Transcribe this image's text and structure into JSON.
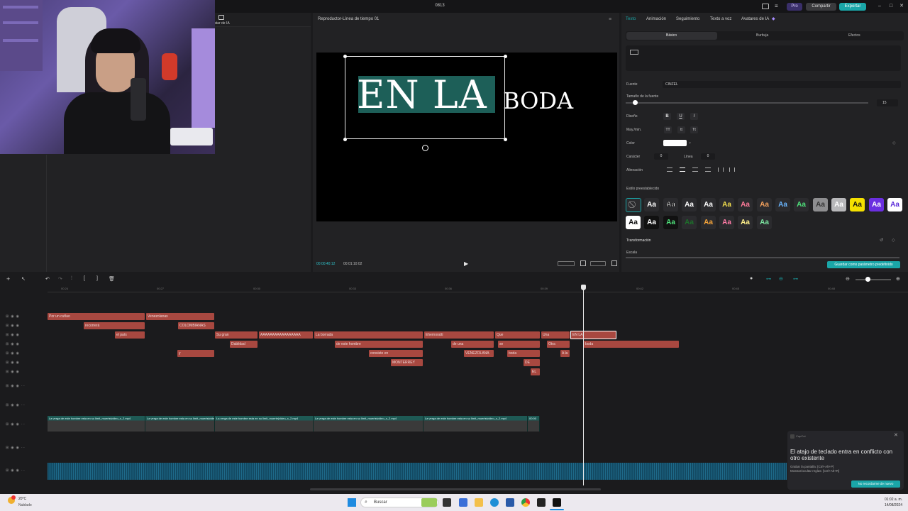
{
  "window": {
    "title": "0813",
    "pro": "Pro",
    "share": "Compartir",
    "export": "Exportar"
  },
  "left_panel": {
    "item_label": "atar de IA"
  },
  "player": {
    "title": "Reproductor-Línea de tiempo 01",
    "overlay_main": "EN LA",
    "overlay_second": "BODA",
    "time_current": "00:00:40:12",
    "time_total": "00:01:10:02"
  },
  "inspector": {
    "tabs": [
      "Texto",
      "Animación",
      "Seguimiento",
      "Texto a voz",
      "Avatares de IA"
    ],
    "subtabs": [
      "Básico",
      "Burbuja",
      "Efectos"
    ],
    "font_label": "Fuente",
    "font_value": "CINZEL",
    "size_label": "Tamaño de la fuente",
    "size_value": "15",
    "size_fraction": 0.04,
    "design_label": "Diseño",
    "case_label": "May./min.",
    "case_buttons": [
      "TT",
      "tt",
      "Tt"
    ],
    "color_label": "Color",
    "color_value": "#ffffff",
    "char_label": "Carácter",
    "char_value": "0",
    "line_label": "Línea",
    "line_value": "0",
    "align_label": "Alineación",
    "preset_label": "Estilo preestablecido",
    "transform_label": "Transformación",
    "scale_label": "Escala",
    "save_preset": "Guardar como parámetro predefinido",
    "preset_glyph": "Aa"
  },
  "timeline": {
    "ruler": [
      "00:24",
      "00:27",
      "00:30",
      "00:33",
      "00:36",
      "00:39",
      "00:42",
      "00:45",
      "00:48"
    ],
    "clips": [
      "Por un cuñao",
      "Venezolanas",
      "recorrerá",
      "COLOMBIANAS",
      "el país",
      "Su gran",
      "AAAAAAAAAAAAAAAAA",
      "La borrada",
      "Ehernoratti",
      "Que",
      "Una",
      "EN LA",
      "Dablidad",
      "de este hombre",
      "de una",
      "se",
      "Otra",
      "boda",
      "y",
      "consiste en",
      "VENEZOLANA",
      "boda",
      "A la",
      "MONTERREY",
      "DE",
      "EL"
    ],
    "video_label": "La verga de este hombre esta en su limit_muerte|video_x_2.mp4",
    "video_duration": "00:00"
  },
  "notification": {
    "app": "CapCut",
    "title": "El atajo de teclado entra en conflicto con otro existente",
    "line1": "Grabar la pantalla: [Ctrl+Alt+P]",
    "line2": "Mostrar/ocultar reglas: [Ctrl+Alt+R]",
    "button": "No recordarme de nuevo"
  },
  "taskbar": {
    "weather_temp": "20°C",
    "weather_desc": "Nublado",
    "search": "Buscar",
    "time": "01:02 a. m.",
    "date": "14/08/2024"
  },
  "colors": {
    "accent": "#1aa6a8",
    "clip": "#a84840",
    "highlight": "#1d5f58"
  }
}
